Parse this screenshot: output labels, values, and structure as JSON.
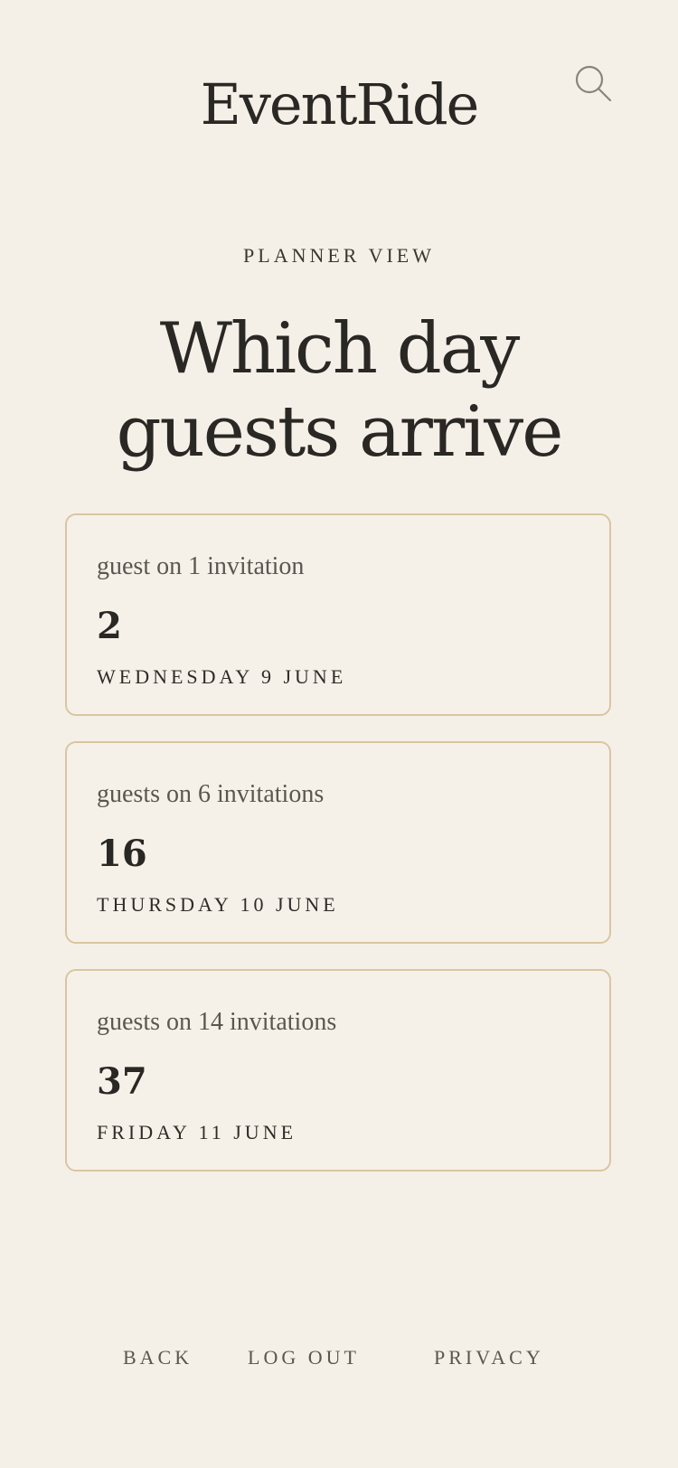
{
  "header": {
    "logo": "EventRide",
    "search_icon": "search-icon"
  },
  "eyebrow": "PLANNER VIEW",
  "title": "Which day guests arrive",
  "days": [
    {
      "count_label": "guest on 1 invitation",
      "count": "2",
      "day": "WEDNESDAY 9 JUNE"
    },
    {
      "count_label": "guests on 6 invitations",
      "count": "16",
      "day": "THURSDAY 10 JUNE"
    },
    {
      "count_label": "guests on 14 invitations",
      "count": "37",
      "day": "FRIDAY 11 JUNE"
    }
  ],
  "footer": {
    "back": "BACK",
    "logout": "LOG OUT",
    "privacy": "PRIVACY"
  },
  "colors": {
    "background": "#f5f0e7",
    "card_border": "#d9c6a0",
    "text_dark": "#2a2824",
    "text_muted": "#5a5650",
    "icon": "#8a857c"
  }
}
